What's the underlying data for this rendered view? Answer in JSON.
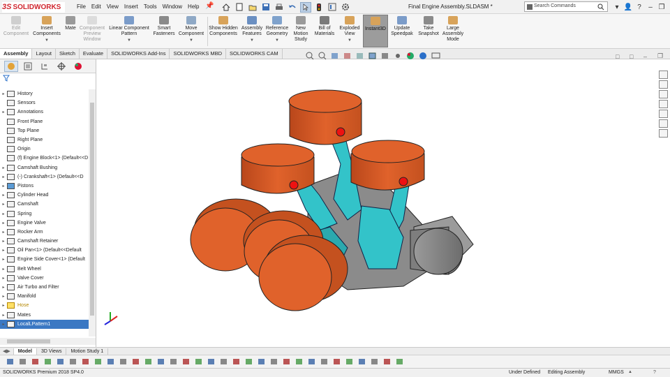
{
  "app": {
    "brand": "SOLIDWORKS",
    "brand_prefix": "3S",
    "document_title": "Final Engine Assembly.SLDASM *"
  },
  "menus": [
    "File",
    "Edit",
    "View",
    "Insert",
    "Tools",
    "Window",
    "Help"
  ],
  "search": {
    "placeholder": "Search Commands"
  },
  "quick_tools": [
    "home-icon",
    "new-doc-icon",
    "open-icon",
    "save-icon",
    "print-icon",
    "undo-icon",
    "select-arrow-icon",
    "traffic-light-icon",
    "file-properties-icon",
    "options-gear-icon"
  ],
  "window_controls": [
    "expand-icon",
    "user-icon",
    "help-icon",
    "minimize-icon",
    "restore-icon",
    "close-icon"
  ],
  "commands": [
    {
      "label": "Edit Component",
      "icon": "edit-component-icon",
      "disabled": true
    },
    {
      "label": "Insert Components",
      "icon": "insert-components-icon",
      "disabled": false
    },
    {
      "label": "Mate",
      "icon": "mate-icon",
      "disabled": false
    },
    {
      "label": "Component Preview Window",
      "icon": "component-preview-icon",
      "disabled": true
    },
    {
      "label": "Linear Component Pattern",
      "icon": "linear-pattern-icon",
      "disabled": false
    },
    {
      "label": "Smart Fasteners",
      "icon": "smart-fasteners-icon",
      "disabled": false
    },
    {
      "label": "Move Component",
      "icon": "move-component-icon",
      "disabled": false
    },
    {
      "label": "Show Hidden Components",
      "icon": "show-hidden-icon",
      "disabled": false
    },
    {
      "label": "Assembly Features",
      "icon": "assembly-features-icon",
      "disabled": false
    },
    {
      "label": "Reference Geometry",
      "icon": "reference-geometry-icon",
      "disabled": false
    },
    {
      "label": "New Motion Study",
      "icon": "motion-study-icon",
      "disabled": false
    },
    {
      "label": "Bill of Materials",
      "icon": "bom-icon",
      "disabled": false
    },
    {
      "label": "Exploded View",
      "icon": "exploded-view-icon",
      "disabled": false
    },
    {
      "label": "Instant3D",
      "icon": "instant3d-icon",
      "disabled": false,
      "active": true
    },
    {
      "label": "Update Speedpak",
      "icon": "speedpak-icon",
      "disabled": false
    },
    {
      "label": "Take Snapshot",
      "icon": "snapshot-icon",
      "disabled": false
    },
    {
      "label": "Large Assembly Mode",
      "icon": "large-assembly-icon",
      "disabled": false
    }
  ],
  "ribbon_tabs": [
    "Assembly",
    "Layout",
    "Sketch",
    "Evaluate",
    "SOLIDWORKS Add-Ins",
    "SOLIDWORKS MBD",
    "SOLIDWORKS CAM"
  ],
  "tree": [
    {
      "label": "History",
      "icon": "history-icon",
      "expand": true
    },
    {
      "label": "Sensors",
      "icon": "sensors-icon",
      "expand": false
    },
    {
      "label": "Annotations",
      "icon": "annotations-icon",
      "expand": true
    },
    {
      "label": "Front Plane",
      "icon": "plane-icon",
      "expand": false
    },
    {
      "label": "Top Plane",
      "icon": "plane-icon",
      "expand": false
    },
    {
      "label": "Right Plane",
      "icon": "plane-icon",
      "expand": false
    },
    {
      "label": "Origin",
      "icon": "origin-icon",
      "expand": false
    },
    {
      "label": "(f) Engine Block<1> (Default<<D",
      "icon": "part-icon",
      "expand": false
    },
    {
      "label": "Camshaft Bushing",
      "icon": "folder-icon",
      "expand": true
    },
    {
      "label": "(-) Crankshaft<1> (Default<<D",
      "icon": "subassembly-icon",
      "expand": true
    },
    {
      "label": "Pistons",
      "icon": "folder-blue-icon",
      "expand": true
    },
    {
      "label": "Cylinder Head",
      "icon": "folder-icon",
      "expand": true
    },
    {
      "label": "Camshaft",
      "icon": "folder-icon",
      "expand": true
    },
    {
      "label": "Spring",
      "icon": "folder-icon",
      "expand": true
    },
    {
      "label": "Engine Valve",
      "icon": "folder-icon",
      "expand": true
    },
    {
      "label": "Rocker Arm",
      "icon": "folder-icon",
      "expand": true
    },
    {
      "label": "Camshaft Retainer",
      "icon": "folder-icon",
      "expand": true
    },
    {
      "label": "Oil Pan<1> (Default<<Default",
      "icon": "part-icon",
      "expand": true
    },
    {
      "label": "Engine Side Cover<1> (Default",
      "icon": "part-icon",
      "expand": true
    },
    {
      "label": "Belt Wheel",
      "icon": "folder-icon",
      "expand": true
    },
    {
      "label": "Valve Cover",
      "icon": "folder-icon",
      "expand": true
    },
    {
      "label": "Air Turbo and Filter",
      "icon": "folder-icon",
      "expand": true
    },
    {
      "label": "Manifold",
      "icon": "folder-icon",
      "expand": true
    },
    {
      "label": "Hose",
      "icon": "folder-warning-icon",
      "expand": true,
      "warning": true
    },
    {
      "label": "Mates",
      "icon": "mates-icon",
      "expand": true
    },
    {
      "label": "LocalLPattern1",
      "icon": "pattern-icon",
      "expand": true,
      "selected": true
    }
  ],
  "bottom_tabs": [
    "Model",
    "3D Views",
    "Motion Study 1"
  ],
  "status": {
    "product": "SOLIDWORKS Premium 2018 SP4.0",
    "definition": "Under Defined",
    "mode": "Editing Assembly",
    "units": "MMGS"
  },
  "colors": {
    "piston": "#e0622b",
    "rod": "#33c3c9",
    "crank": "#8e8e8e",
    "accent": "#3b78c3",
    "brand": "#d0262f"
  }
}
